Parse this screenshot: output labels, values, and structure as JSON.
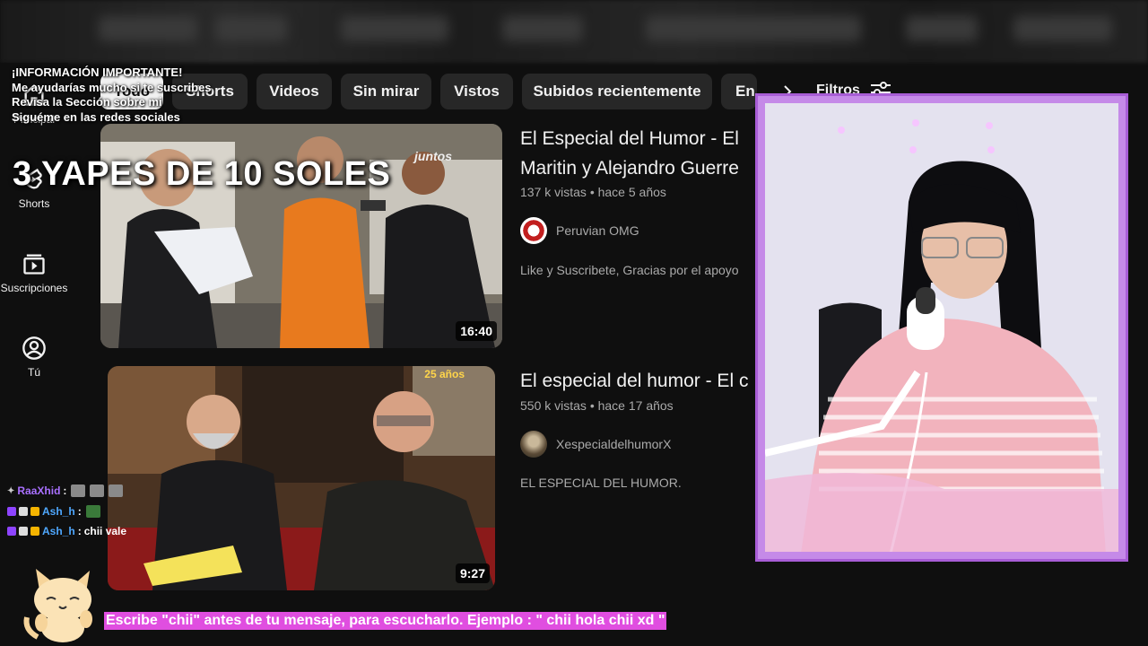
{
  "sidebar": {
    "items": [
      {
        "label": "Principal",
        "icon": "home-icon"
      },
      {
        "label": "Shorts",
        "icon": "shorts-icon"
      },
      {
        "label": "Suscripciones",
        "icon": "subscriptions-icon"
      },
      {
        "label": "Tú",
        "icon": "user-icon"
      }
    ]
  },
  "chips": [
    "Todo",
    "Shorts",
    "Videos",
    "Sin mirar",
    "Vistos",
    "Subidos recientemente",
    "En"
  ],
  "filters_label": "Filtros",
  "videos": [
    {
      "title_line1": "El Especial del Humor - El",
      "title_line2": "Maritin y Alejandro Guerre",
      "meta": "137 k vistas • hace 5 años",
      "channel": "Peruvian OMG",
      "description": "Like y Suscribete, Gracias por el apoyo",
      "duration": "16:40",
      "thumb_logo": "juntos"
    },
    {
      "title_line1": "El especial del humor - El c",
      "meta": "550 k vistas • hace 17 años",
      "channel": "XespecialdelhumorX",
      "description": "EL ESPECIAL DEL HUMOR.",
      "duration": "9:27",
      "thumb_logo": "25 años"
    }
  ],
  "overlay": {
    "info_lines": [
      "¡INFORMACIÓN IMPORTANTE!",
      "Me ayudarías mucho si te suscribes",
      "Revisa la Sección sobre mi",
      "Siguéme en las redes sociales"
    ],
    "yapes": "3 YAPES DE 10 SOLES"
  },
  "chat": [
    {
      "user": "RaaXhid",
      "sep": ":",
      "message": "",
      "user_color": "#a970ff"
    },
    {
      "user": "Ash_h",
      "sep": ":",
      "message": "",
      "user_color": "#4fa8ff"
    },
    {
      "user": "Ash_h",
      "sep": ":",
      "message": "chii vale",
      "user_color": "#4fa8ff"
    }
  ],
  "banner": "Escribe \"chii\" antes de tu mensaje, para escucharlo. Ejemplo : \" chii hola chii xd \"",
  "colors": {
    "background": "#0f0f0f",
    "chip": "#272727",
    "webcam_frame": "#c58ae8",
    "banner": "#e04ee0"
  }
}
